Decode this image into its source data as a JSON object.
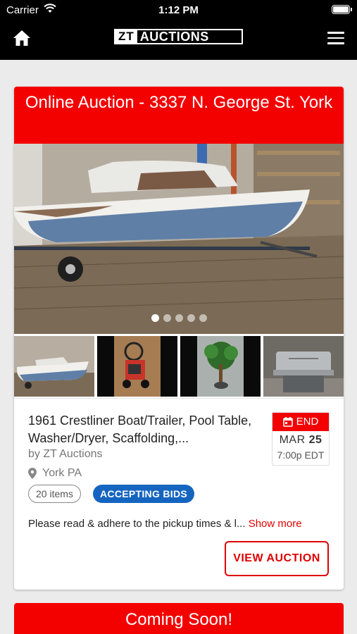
{
  "status_bar": {
    "carrier": "Carrier",
    "time": "1:12 PM"
  },
  "header": {
    "logo_zt": "ZT",
    "logo_word": "AUCTIONS"
  },
  "auction": {
    "title": "Online Auction - 3337 N. George St. York",
    "photo_count": 5,
    "active_photo": 1,
    "lot_title": "1961 Crestliner Boat/Trailer, Pool Table, Washer/Dryer, Scaffolding,...",
    "by": "by ZT Auctions",
    "location": "York PA",
    "items_count": "20 items",
    "status": "ACCEPTING BIDS",
    "end": {
      "label": "END",
      "month": "MAR",
      "day": "25",
      "time": "7:00p EDT"
    },
    "description": "Please read & adhere to the pickup times & l...",
    "show_more": "Show more",
    "view_button": "VIEW AUCTION"
  },
  "next_auction": {
    "title": "Coming Soon!"
  },
  "colors": {
    "brand_red": "#f30000",
    "badge_blue": "#1565c0",
    "header_black": "#000000"
  }
}
